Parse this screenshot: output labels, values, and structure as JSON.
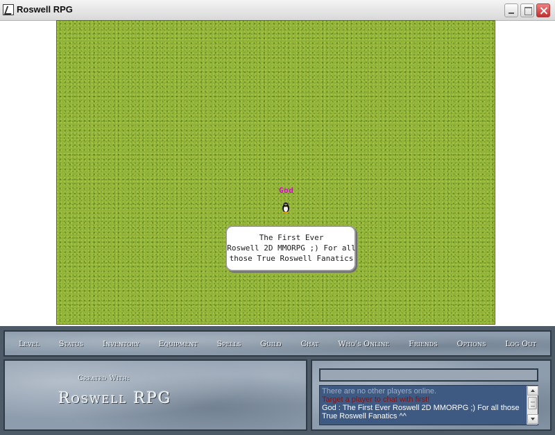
{
  "window": {
    "title": "Roswell RPG",
    "icon": "app-icon"
  },
  "game": {
    "player_name": "God",
    "player_name_color": "#e000e0",
    "speech": "The First Ever\nRoswell 2D MMORPG ;) For all\nthose True Roswell Fanatics",
    "terrain": "grass",
    "colors": {
      "grass": "#8fb23a"
    }
  },
  "menu": {
    "items": [
      {
        "label": "Level"
      },
      {
        "label": "Status"
      },
      {
        "label": "Inventory"
      },
      {
        "label": "Equipment"
      },
      {
        "label": "Spells"
      },
      {
        "label": "Guild"
      },
      {
        "label": "Chat"
      },
      {
        "label": "Who's Online"
      },
      {
        "label": "Friends"
      },
      {
        "label": "Options"
      },
      {
        "label": "Log Out"
      }
    ]
  },
  "credits": {
    "label": "Created With:",
    "logo": "Roswell RPG"
  },
  "chat": {
    "input_value": "",
    "messages": [
      {
        "text": "There are no other players online.",
        "style": "faded"
      },
      {
        "text": "Target a player to chat with first!",
        "style": "error"
      },
      {
        "text": "God : The First Ever Roswell 2D MMORPG ;) For all those True Roswell Fanatics ^^",
        "style": "normal"
      }
    ],
    "colors": {
      "error": "#8a1010",
      "log_bg": "#3f5a82"
    }
  }
}
